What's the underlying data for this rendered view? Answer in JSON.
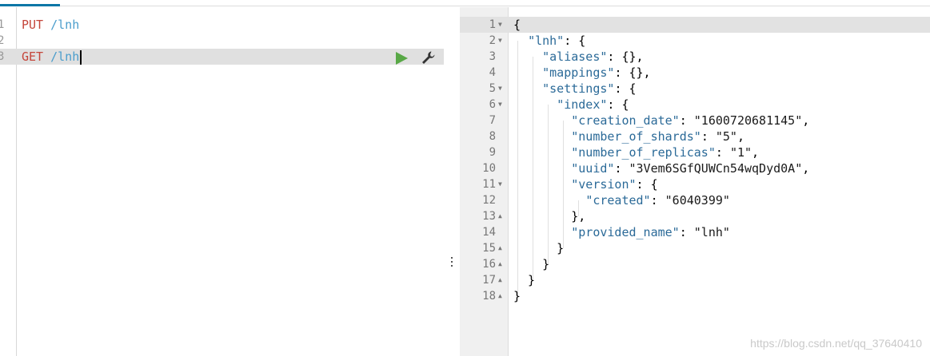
{
  "request_editor": {
    "lines": [
      {
        "number": "1",
        "method": "PUT",
        "path": "/lnh"
      },
      {
        "number": "2",
        "method": "",
        "path": ""
      },
      {
        "number": "3",
        "method": "GET",
        "path": "/lnh"
      }
    ],
    "active_line": 3,
    "run_icon": "play-icon",
    "settings_icon": "wrench-icon",
    "colors": {
      "method": "#c5453a",
      "path": "#4a9dcc",
      "run": "#58a846"
    }
  },
  "response_viewer": {
    "lines": [
      {
        "n": "1",
        "fold": "▼",
        "text": "{"
      },
      {
        "n": "2",
        "fold": "▼",
        "text": "  \"lnh\": {"
      },
      {
        "n": "3",
        "fold": "",
        "text": "    \"aliases\": {},"
      },
      {
        "n": "4",
        "fold": "",
        "text": "    \"mappings\": {},"
      },
      {
        "n": "5",
        "fold": "▼",
        "text": "    \"settings\": {"
      },
      {
        "n": "6",
        "fold": "▼",
        "text": "      \"index\": {"
      },
      {
        "n": "7",
        "fold": "",
        "text": "        \"creation_date\": \"1600720681145\","
      },
      {
        "n": "8",
        "fold": "",
        "text": "        \"number_of_shards\": \"5\","
      },
      {
        "n": "9",
        "fold": "",
        "text": "        \"number_of_replicas\": \"1\","
      },
      {
        "n": "10",
        "fold": "",
        "text": "        \"uuid\": \"3Vem6SGfQUWCn54wqDyd0A\","
      },
      {
        "n": "11",
        "fold": "▼",
        "text": "        \"version\": {"
      },
      {
        "n": "12",
        "fold": "",
        "text": "          \"created\": \"6040399\""
      },
      {
        "n": "13",
        "fold": "▲",
        "text": "        },"
      },
      {
        "n": "14",
        "fold": "",
        "text": "        \"provided_name\": \"lnh\""
      },
      {
        "n": "15",
        "fold": "▲",
        "text": "      }"
      },
      {
        "n": "16",
        "fold": "▲",
        "text": "    }"
      },
      {
        "n": "17",
        "fold": "▲",
        "text": "  }"
      },
      {
        "n": "18",
        "fold": "▲",
        "text": "}"
      }
    ],
    "active_line": 1
  },
  "watermark": "https://blog.csdn.net/qq_37640410"
}
